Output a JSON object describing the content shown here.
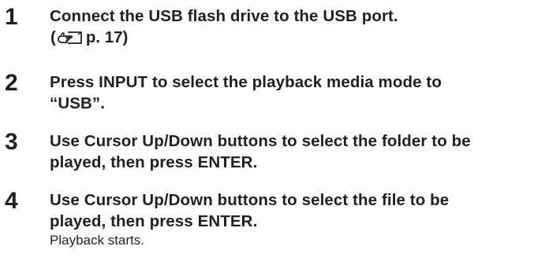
{
  "steps": [
    {
      "number": "1",
      "text": "Connect the USB flash drive to the USB port.",
      "page_ref": {
        "open": "(",
        "icon": "pointing-hand-page-reference-icon",
        "label": "p. 17)"
      }
    },
    {
      "number": "2",
      "text": "Press INPUT to select the playback media mode to\n“USB”."
    },
    {
      "number": "3",
      "text": "Use Cursor Up/Down buttons to select the folder to be\nplayed, then press ENTER."
    },
    {
      "number": "4",
      "text": "Use Cursor Up/Down buttons to select the file to be\nplayed, then press ENTER.",
      "note": "Playback starts."
    }
  ]
}
